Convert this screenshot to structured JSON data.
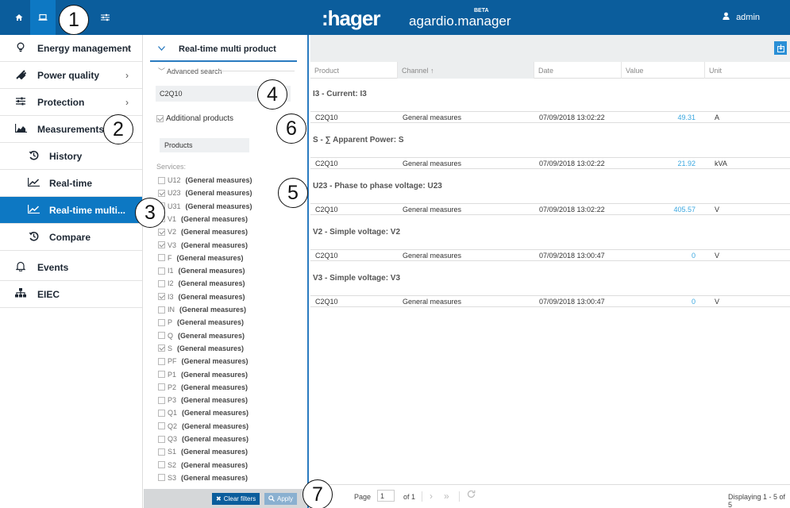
{
  "topbar": {
    "icons": [
      "home-icon",
      "laptop-icon",
      "sliders-icon"
    ],
    "brand": "hager",
    "brand_colon": ":",
    "product": "agardio.manager",
    "beta": "BETA",
    "user": "admin"
  },
  "nav": {
    "items": [
      {
        "label": "Energy management",
        "icon": "lightbulb-icon",
        "chevron": "›"
      },
      {
        "label": "Power quality",
        "icon": "plug-icon",
        "chevron": "›"
      },
      {
        "label": "Protection",
        "icon": "sliders-icon",
        "chevron": "›"
      },
      {
        "label": "Measurements",
        "icon": "chart-area-icon"
      },
      {
        "label": "History",
        "icon": "history-icon"
      },
      {
        "label": "Real-time",
        "icon": "line-chart-icon"
      },
      {
        "label": "Real-time multi...",
        "icon": "line-chart-icon"
      },
      {
        "label": "Compare",
        "icon": "history-icon"
      },
      {
        "label": "Events",
        "icon": "bell-icon"
      },
      {
        "label": "EIEC",
        "icon": "sitemap-icon"
      }
    ]
  },
  "panel": {
    "title": "Real-time multi product",
    "advanced": "Advanced search",
    "product_select": "C2Q10",
    "additional_label": "Additional products",
    "products_select": "Products",
    "services_title": "Services:",
    "services": [
      {
        "code": "U12",
        "label": "(General measures)",
        "checked": false
      },
      {
        "code": "U23",
        "label": "(General measures)",
        "checked": true
      },
      {
        "code": "U31",
        "label": "(General measures)",
        "checked": false
      },
      {
        "code": "V1",
        "label": "(General measures)",
        "checked": false
      },
      {
        "code": "V2",
        "label": "(General measures)",
        "checked": true
      },
      {
        "code": "V3",
        "label": "(General measures)",
        "checked": true
      },
      {
        "code": "F",
        "label": "(General measures)",
        "checked": false
      },
      {
        "code": "I1",
        "label": "(General measures)",
        "checked": false
      },
      {
        "code": "I2",
        "label": "(General measures)",
        "checked": false
      },
      {
        "code": "I3",
        "label": "(General measures)",
        "checked": true
      },
      {
        "code": "IN",
        "label": "(General measures)",
        "checked": false
      },
      {
        "code": "P",
        "label": "(General measures)",
        "checked": false
      },
      {
        "code": "Q",
        "label": "(General measures)",
        "checked": false
      },
      {
        "code": "S",
        "label": "(General measures)",
        "checked": true
      },
      {
        "code": "PF",
        "label": "(General measures)",
        "checked": false
      },
      {
        "code": "P1",
        "label": "(General measures)",
        "checked": false
      },
      {
        "code": "P2",
        "label": "(General measures)",
        "checked": false
      },
      {
        "code": "P3",
        "label": "(General measures)",
        "checked": false
      },
      {
        "code": "Q1",
        "label": "(General measures)",
        "checked": false
      },
      {
        "code": "Q2",
        "label": "(General measures)",
        "checked": false
      },
      {
        "code": "Q3",
        "label": "(General measures)",
        "checked": false
      },
      {
        "code": "S1",
        "label": "(General measures)",
        "checked": false
      },
      {
        "code": "S2",
        "label": "(General measures)",
        "checked": false
      },
      {
        "code": "S3",
        "label": "(General measures)",
        "checked": false
      }
    ],
    "clear_label": "Clear filters",
    "apply_label": "Apply"
  },
  "table": {
    "headers": [
      "Product",
      "Channel ↑",
      "Date",
      "Value",
      "Unit"
    ],
    "groups": [
      {
        "title": "I3 - Current: I3",
        "product": "C2Q10",
        "channel": "General measures",
        "date": "07/09/2018 13:02:22",
        "value": "49.31",
        "unit": "A"
      },
      {
        "title": "S - ∑ Apparent Power: S",
        "product": "C2Q10",
        "channel": "General measures",
        "date": "07/09/2018 13:02:22",
        "value": "21.92",
        "unit": "kVA"
      },
      {
        "title": "U23 - Phase to phase voltage: U23",
        "product": "C2Q10",
        "channel": "General measures",
        "date": "07/09/2018 13:02:22",
        "value": "405.57",
        "unit": "V"
      },
      {
        "title": "V2 - Simple voltage: V2",
        "product": "C2Q10",
        "channel": "General measures",
        "date": "07/09/2018 13:00:47",
        "value": "0",
        "unit": "V"
      },
      {
        "title": "V3 - Simple voltage: V3",
        "product": "C2Q10",
        "channel": "General measures",
        "date": "07/09/2018 13:00:47",
        "value": "0",
        "unit": "V"
      }
    ]
  },
  "pager": {
    "page_label": "Page",
    "page_value": "1",
    "of_label": "of 1",
    "displaying": "Displaying 1 - 5 of 5"
  },
  "callouts": [
    "1",
    "2",
    "3",
    "4",
    "5",
    "6",
    "7"
  ],
  "colors": {
    "topbar": "#0b5d9c",
    "accent": "#0d78c3",
    "value": "#3aa7e0"
  }
}
